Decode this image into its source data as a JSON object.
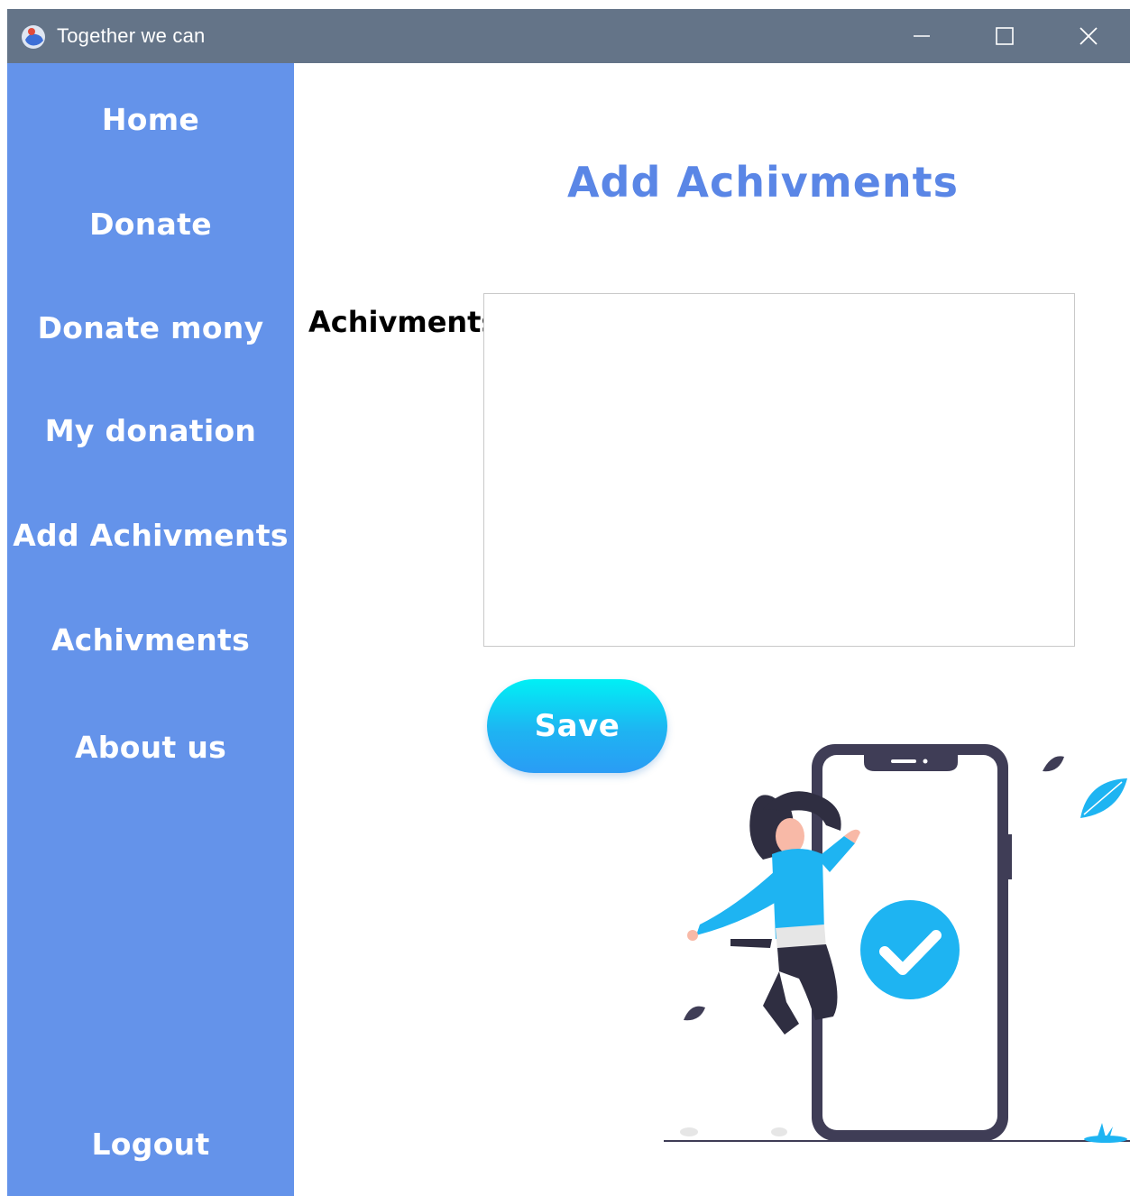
{
  "window": {
    "title": "Together we can"
  },
  "sidebar": {
    "items": [
      {
        "label": "Home"
      },
      {
        "label": "Donate"
      },
      {
        "label": "Donate mony"
      },
      {
        "label": "My donation"
      },
      {
        "label": "Add Achivments"
      },
      {
        "label": "Achivments"
      },
      {
        "label": "About us"
      },
      {
        "label": "Logout"
      }
    ]
  },
  "main": {
    "title": "Add Achivments",
    "field_label": "Achivments",
    "field_value": "",
    "save_label": "Save"
  },
  "colors": {
    "titlebar": "#647488",
    "sidebar": "#6493EA",
    "title": "#5A86E6",
    "accent": "#1EB4F2"
  },
  "icons": {
    "app": "app-globe-icon",
    "minimize": "minimize-icon",
    "maximize": "maximize-icon",
    "close": "close-icon"
  }
}
